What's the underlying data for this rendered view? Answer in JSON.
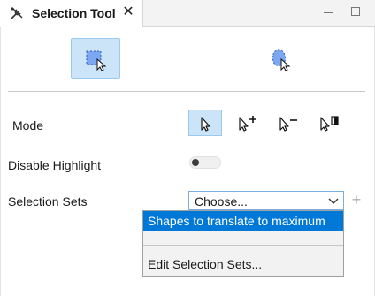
{
  "tab": {
    "title": "Selection Tool",
    "close_glyph": "✕",
    "icon": "tools-icon"
  },
  "window_controls": {
    "minimize_icon": "minimize-icon",
    "maximize_icon": "maximize-icon"
  },
  "tools": [
    {
      "name": "rectangle-select",
      "icon": "rectangle-selection-icon",
      "selected": true
    },
    {
      "name": "lasso-select",
      "icon": "lasso-selection-icon",
      "selected": false
    }
  ],
  "mode": {
    "label": "Mode",
    "buttons": [
      {
        "name": "mode-replace",
        "icon": "pointer-icon",
        "selected": true
      },
      {
        "name": "mode-add",
        "icon": "pointer-plus-icon",
        "selected": false
      },
      {
        "name": "mode-subtract",
        "icon": "pointer-minus-icon",
        "selected": false
      },
      {
        "name": "mode-intersect",
        "icon": "pointer-intersect-icon",
        "selected": false
      }
    ]
  },
  "disable_highlight": {
    "label": "Disable Highlight",
    "on": false
  },
  "selection_sets": {
    "label": "Selection Sets",
    "combo_value": "Choose...",
    "add_glyph": "+",
    "options": [
      {
        "label": "Shapes to translate to maximum",
        "highlighted": true
      },
      {
        "label": "",
        "highlighted": false
      }
    ],
    "edit_label": "Edit Selection Sets..."
  },
  "colors": {
    "accent": "#0078d7",
    "selected_bg": "#cce4f7",
    "selected_border": "#99c9ef",
    "shape_fill": "#7da7f0"
  }
}
